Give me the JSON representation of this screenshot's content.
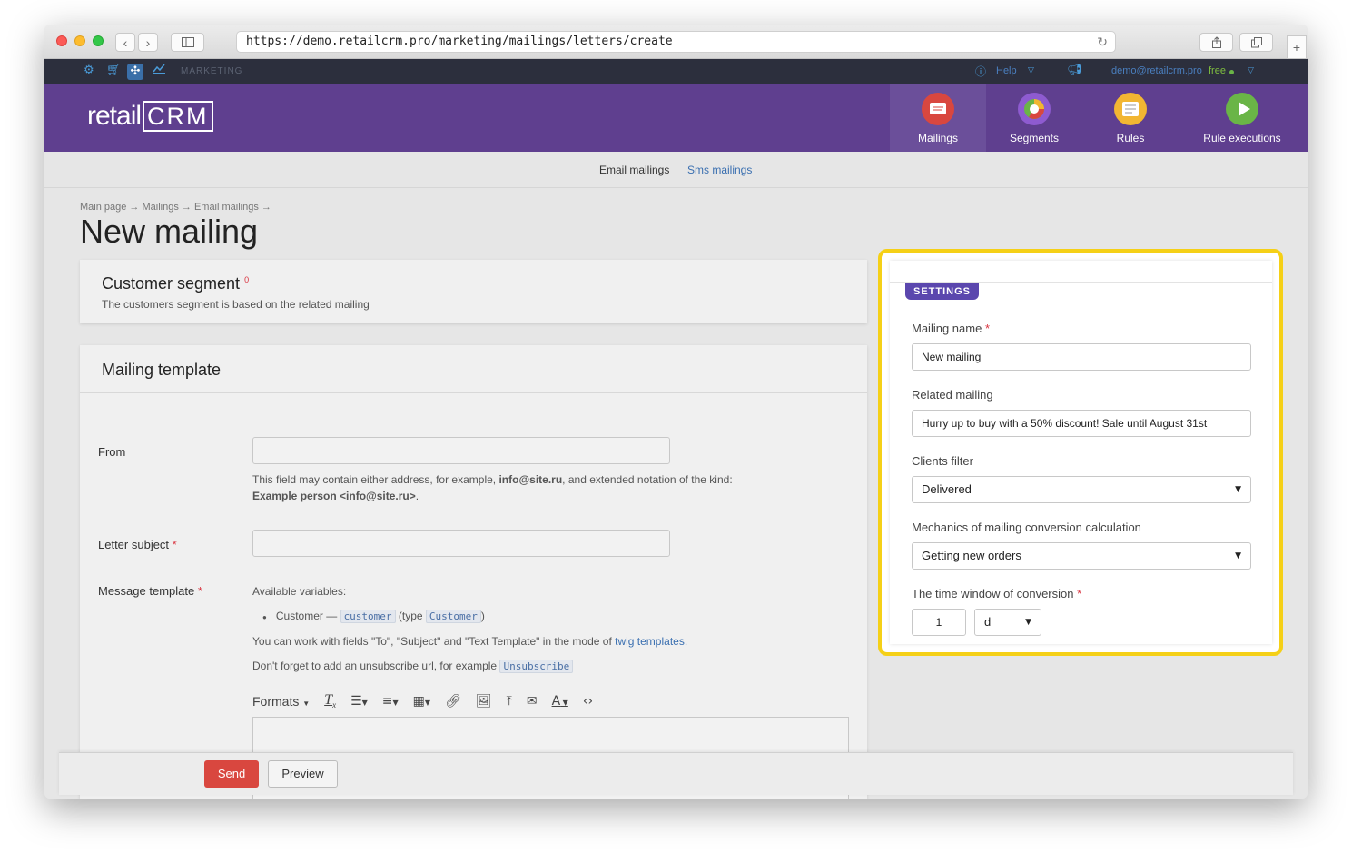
{
  "browser": {
    "url": "https://demo.retailcrm.pro/marketing/mailings/letters/create"
  },
  "topbar": {
    "section": "MARKETING",
    "help": "Help",
    "user_email": "demo@retailcrm.pro",
    "plan": "free"
  },
  "header": {
    "logo": "retail",
    "logo_mark": "CRM",
    "modules": [
      {
        "label": "Mailings",
        "color": "#d9473f"
      },
      {
        "label": "Segments",
        "color": "#8e5bd0"
      },
      {
        "label": "Rules",
        "color": "#f2b632"
      },
      {
        "label": "Rule executions",
        "color": "#6ab547"
      }
    ]
  },
  "subnav": {
    "tabs": [
      "Email mailings",
      "Sms mailings"
    ]
  },
  "page": {
    "breadcrumb": "Main page → Mailings → Email mailings →",
    "title": "New mailing"
  },
  "segment": {
    "title": "Customer segment",
    "marker": "0",
    "description": "The customers segment is based on the related mailing"
  },
  "template": {
    "title": "Mailing template",
    "from_label": "From",
    "from_value": "",
    "from_hint_1": "This field may contain either address, for example,",
    "from_hint_email": "info@site.ru",
    "from_hint_2": ", and extended notation of the kind:",
    "from_hint_example": "Example person <info@site.ru>",
    "from_hint_end": ".",
    "subject_label": "Letter subject",
    "subject_value": "",
    "message_label": "Message template",
    "vars_title": "Available variables:",
    "var_name": "Customer —",
    "var_code": "customer",
    "var_type_prefix": "(type",
    "var_type": "Customer",
    "var_type_suffix": ")",
    "twig_text": "You can work with fields \"To\", \"Subject\" and \"Text Template\" in the mode of",
    "twig_link": "twig templates.",
    "unsub_text": "Don't forget to add an unsubscribe url, for example",
    "unsub_code": "Unsubscribe",
    "formats": "Formats"
  },
  "settings": {
    "tag": "SETTINGS",
    "name_label": "Mailing name",
    "name_value": "New mailing",
    "related_label": "Related mailing",
    "related_value": "Hurry up to buy with a 50% discount! Sale until August 31st",
    "filter_label": "Clients filter",
    "filter_value": "Delivered",
    "mechanics_label": "Mechanics of mailing conversion calculation",
    "mechanics_value": "Getting new orders",
    "window_label": "The time window of conversion",
    "window_value": "1",
    "window_unit": "d"
  },
  "actions": {
    "send": "Send",
    "preview": "Preview"
  },
  "colors": {
    "header": "#5f3f8f",
    "highlight": "#f5d017",
    "settings_tag": "#5b47ae",
    "send": "#d9473f"
  }
}
